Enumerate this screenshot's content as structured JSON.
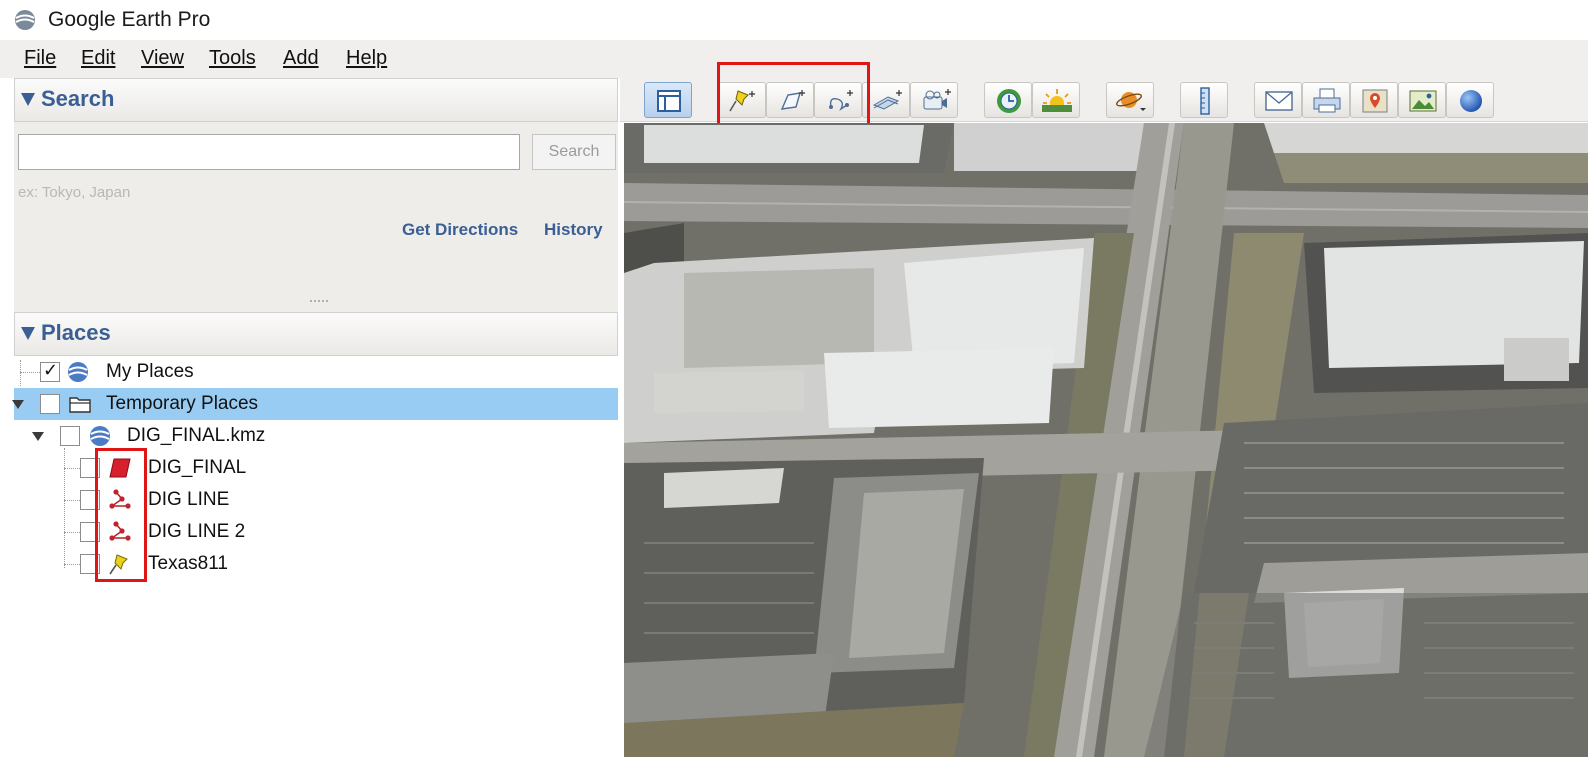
{
  "window": {
    "title": "Google Earth Pro"
  },
  "menu": [
    "File",
    "Edit",
    "View",
    "Tools",
    "Add",
    "Help"
  ],
  "search": {
    "header": "Search",
    "input_value": "",
    "button_label": "Search",
    "hint": "ex: Tokyo, Japan",
    "get_directions": "Get Directions",
    "history": "History"
  },
  "places": {
    "header": "Places",
    "items": [
      {
        "label": "My Places",
        "checked": true,
        "icon": "earth-icon"
      },
      {
        "label": "Temporary Places",
        "checked": false,
        "icon": "folder-icon",
        "selected": true
      },
      {
        "label": "DIG_FINAL.kmz",
        "checked": false,
        "icon": "earth-icon"
      },
      {
        "label": "DIG_FINAL",
        "checked": false,
        "icon": "polygon-icon"
      },
      {
        "label": "DIG LINE",
        "checked": false,
        "icon": "path-icon"
      },
      {
        "label": "DIG LINE 2",
        "checked": false,
        "icon": "path-icon"
      },
      {
        "label": "Texas811",
        "checked": false,
        "icon": "pushpin-icon"
      }
    ]
  },
  "toolbar": [
    "sidebar-toggle-icon",
    "add-placemark-icon",
    "add-polygon-icon",
    "add-path-icon",
    "add-image-overlay-icon",
    "record-tour-icon",
    "historical-imagery-icon",
    "sunlight-icon",
    "planets-icon",
    "ruler-icon",
    "email-icon",
    "print-icon",
    "google-maps-icon",
    "save-image-icon",
    "earth-view-icon"
  ],
  "colors": {
    "accent": "#3a5f94",
    "selection": "#99ccf2",
    "highlight": "#e01515",
    "polygon": "#d81f2e",
    "pushpin": "#e6d21a"
  }
}
